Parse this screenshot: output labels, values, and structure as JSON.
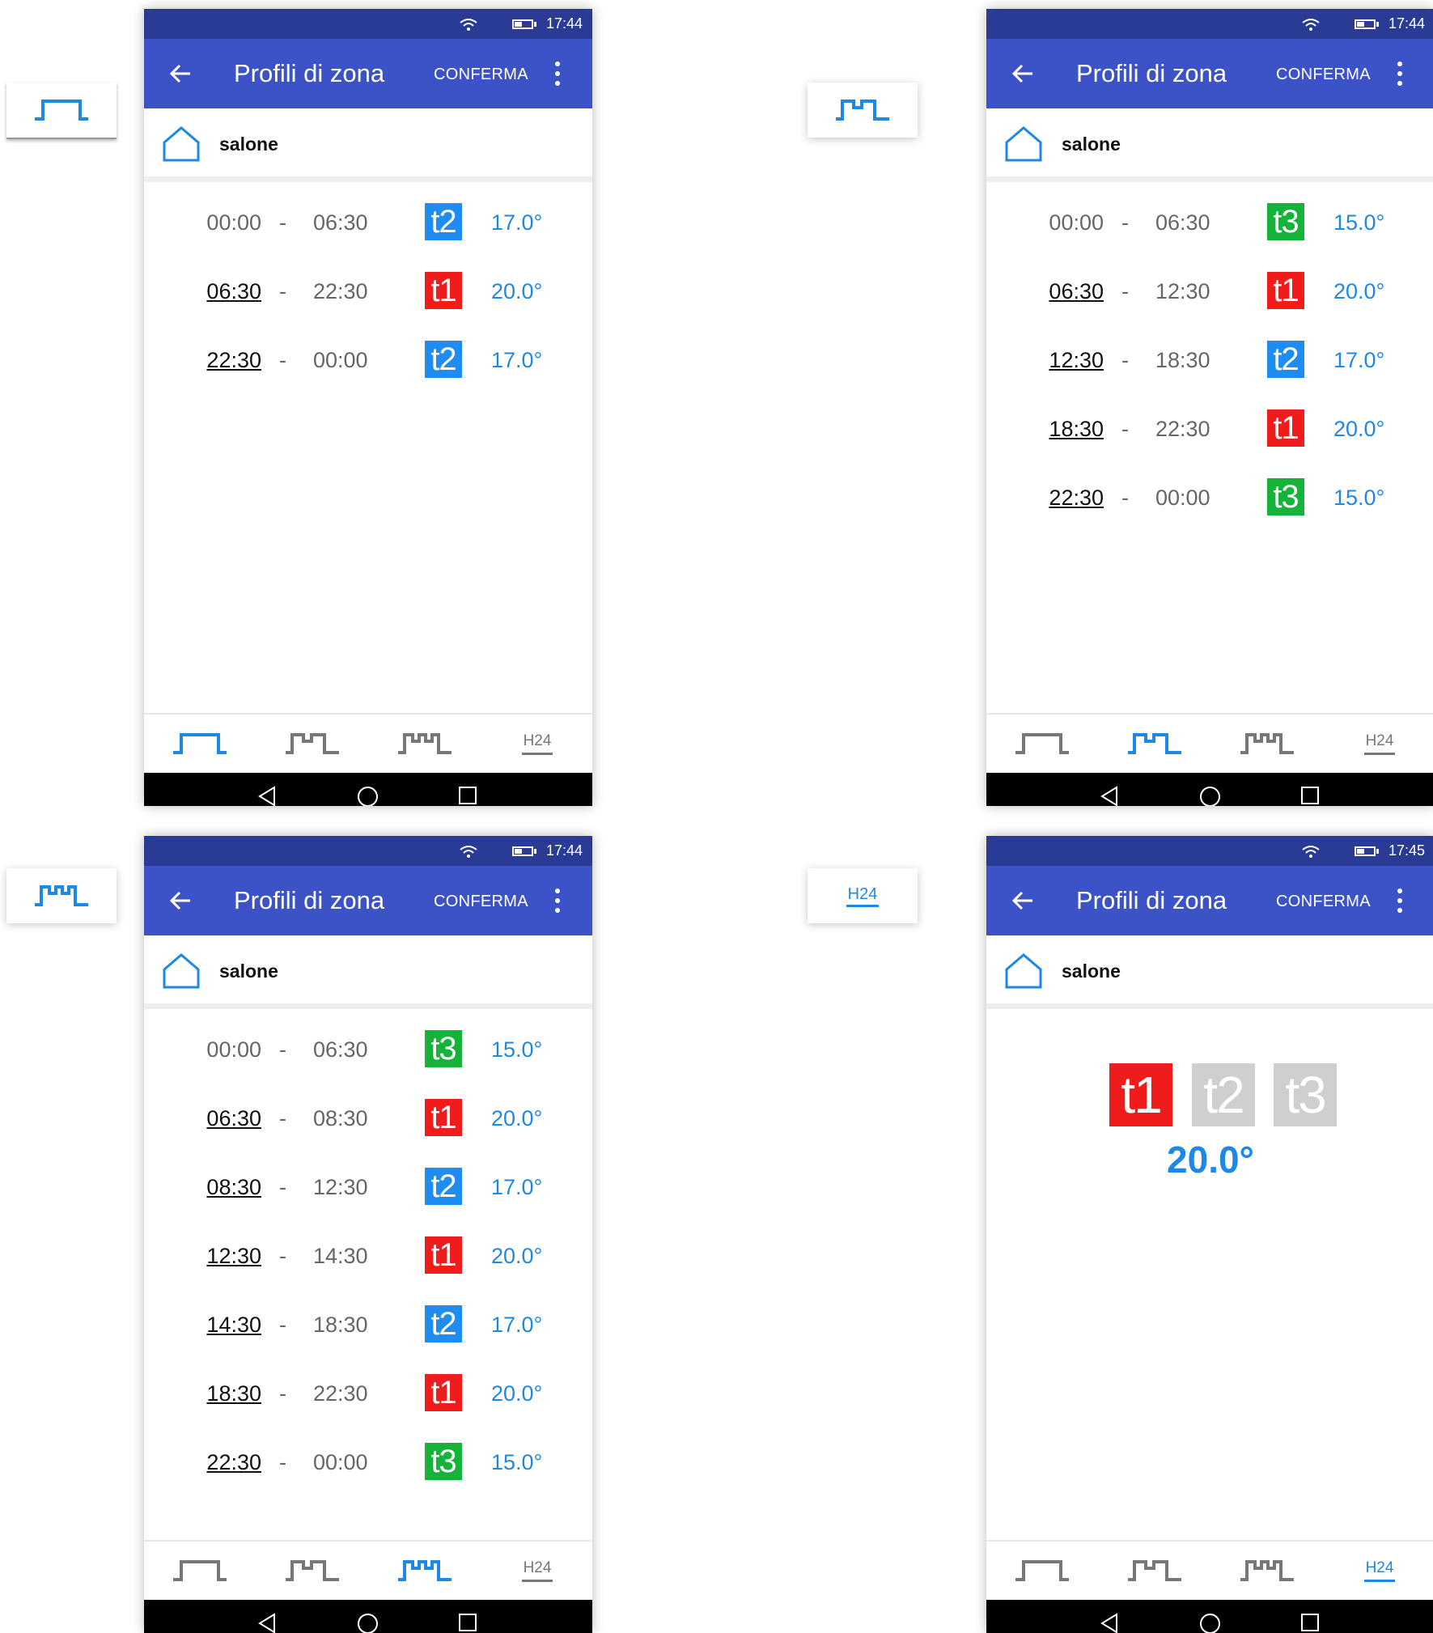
{
  "colors": {
    "appbar": "#3c52c7",
    "statusbar": "#2a3b96",
    "accent": "#1e88e5",
    "t1": "#f01c1c",
    "t2": "#1e8cf0",
    "t3": "#16b33a",
    "inactive": "#cfcfcf"
  },
  "app": {
    "title": "Profili di zona",
    "confirm_label": "CONFERMA",
    "zone_name": "salone"
  },
  "tabs": {
    "h24_label": "H24"
  },
  "legend": {
    "h24_label": "H24"
  },
  "screens": [
    {
      "time": "17:44",
      "active_tab": "profile-1",
      "rows": [
        {
          "start": "00:00",
          "end": "06:30",
          "level": "t2",
          "temp": "17.0°"
        },
        {
          "start": "06:30",
          "end": "22:30",
          "level": "t1",
          "temp": "20.0°"
        },
        {
          "start": "22:30",
          "end": "00:00",
          "level": "t2",
          "temp": "17.0°"
        }
      ]
    },
    {
      "time": "17:44",
      "active_tab": "profile-2",
      "rows": [
        {
          "start": "00:00",
          "end": "06:30",
          "level": "t3",
          "temp": "15.0°"
        },
        {
          "start": "06:30",
          "end": "12:30",
          "level": "t1",
          "temp": "20.0°"
        },
        {
          "start": "12:30",
          "end": "18:30",
          "level": "t2",
          "temp": "17.0°"
        },
        {
          "start": "18:30",
          "end": "22:30",
          "level": "t1",
          "temp": "20.0°"
        },
        {
          "start": "22:30",
          "end": "00:00",
          "level": "t3",
          "temp": "15.0°"
        }
      ]
    },
    {
      "time": "17:44",
      "active_tab": "profile-3",
      "rows": [
        {
          "start": "00:00",
          "end": "06:30",
          "level": "t3",
          "temp": "15.0°"
        },
        {
          "start": "06:30",
          "end": "08:30",
          "level": "t1",
          "temp": "20.0°"
        },
        {
          "start": "08:30",
          "end": "12:30",
          "level": "t2",
          "temp": "17.0°"
        },
        {
          "start": "12:30",
          "end": "14:30",
          "level": "t1",
          "temp": "20.0°"
        },
        {
          "start": "14:30",
          "end": "18:30",
          "level": "t2",
          "temp": "17.0°"
        },
        {
          "start": "18:30",
          "end": "22:30",
          "level": "t1",
          "temp": "20.0°"
        },
        {
          "start": "22:30",
          "end": "00:00",
          "level": "t3",
          "temp": "15.0°"
        }
      ]
    },
    {
      "time": "17:45",
      "active_tab": "h24",
      "h24": {
        "levels": [
          "t1",
          "t2",
          "t3"
        ],
        "selected": "t1",
        "temp": "20.0°"
      }
    }
  ]
}
